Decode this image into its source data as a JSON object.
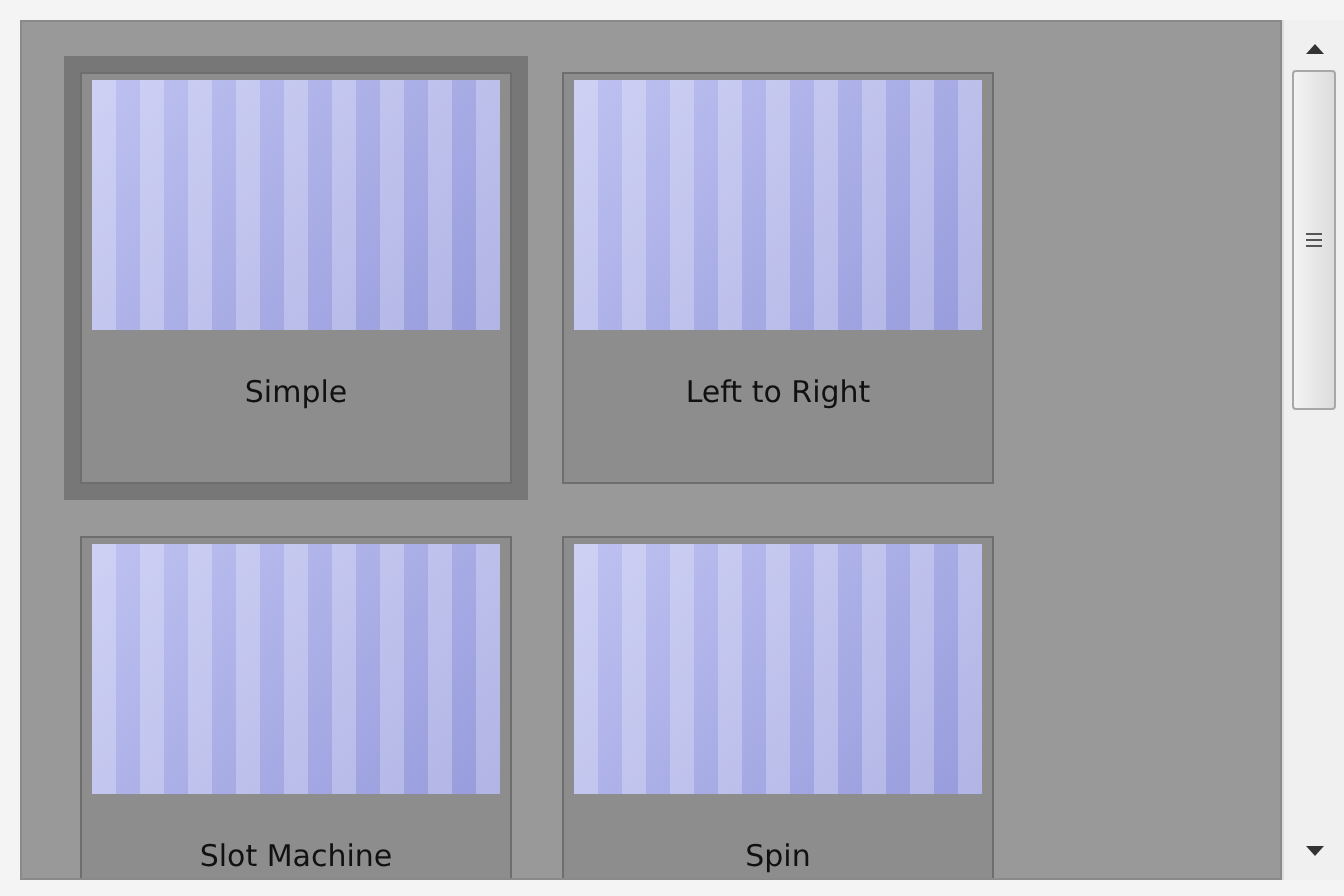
{
  "transitions": [
    {
      "label": "Simple",
      "selected": true
    },
    {
      "label": "Left to Right",
      "selected": false
    },
    {
      "label": "Slot Machine",
      "selected": false
    },
    {
      "label": "Spin",
      "selected": false
    }
  ]
}
